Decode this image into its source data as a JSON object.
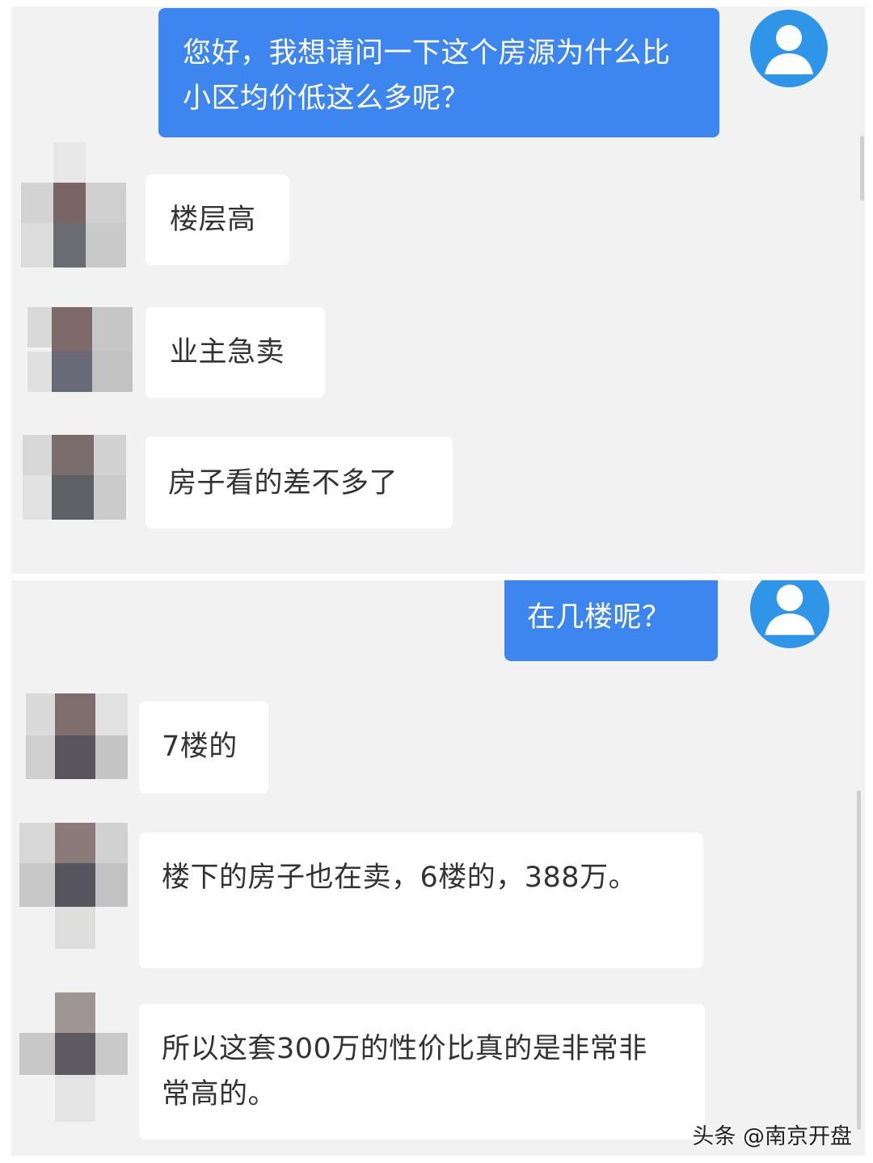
{
  "conversation_top": {
    "user_question": "您好，我想请问一下这个房源为什么比小区均价低这么多呢？",
    "replies": [
      "楼层高",
      "业主急卖",
      "房子看的差不多了"
    ]
  },
  "conversation_bottom": {
    "user_question": "在几楼呢？",
    "replies": [
      "7楼的",
      "楼下的房子也在卖，6楼的，388万。",
      "所以这套300万的性价比真的是非常非常高的。"
    ]
  },
  "watermark": "头条 @南京开盘",
  "icons": {
    "user_avatar": "user-silhouette-icon",
    "agent_avatar": "pixelated-avatar"
  },
  "colors": {
    "outgoing_bubble": "#3d86f0",
    "incoming_bubble": "#ffffff",
    "chat_background": "#f2f2f2",
    "user_avatar": "#2e95e8"
  }
}
